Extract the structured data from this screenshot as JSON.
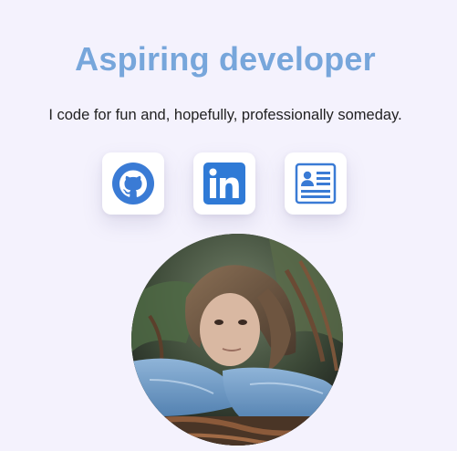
{
  "header": {
    "title": "Aspiring developer",
    "tagline": "I code for fun and, hopefully, professionally someday."
  },
  "socials": [
    {
      "name": "GitHub",
      "icon": "github-icon"
    },
    {
      "name": "LinkedIn",
      "icon": "linkedin-icon"
    },
    {
      "name": "Resume",
      "icon": "resume-icon"
    }
  ],
  "colors": {
    "background": "#f4f2fd",
    "title": "#77a6db",
    "icon_blue": "#3a7bd5",
    "text": "#222222"
  },
  "profile": {
    "image": "profile-photo"
  }
}
